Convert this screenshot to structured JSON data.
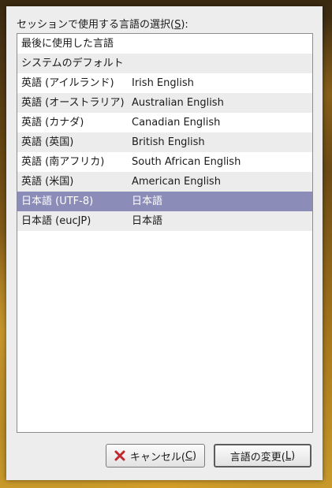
{
  "dialog": {
    "prompt_before": "セッションで使用する言語の選択(",
    "prompt_key": "S",
    "prompt_after": "):"
  },
  "languages": [
    {
      "name": "最後に使用した言語",
      "native": ""
    },
    {
      "name": "システムのデフォルト",
      "native": ""
    },
    {
      "name": "英語 (アイルランド)",
      "native": "Irish English"
    },
    {
      "name": "英語 (オーストラリア)",
      "native": "Australian English"
    },
    {
      "name": "英語 (カナダ)",
      "native": "Canadian English"
    },
    {
      "name": "英語 (英国)",
      "native": "British English"
    },
    {
      "name": "英語 (南アフリカ)",
      "native": "South African English"
    },
    {
      "name": "英語 (米国)",
      "native": "American English"
    },
    {
      "name": "日本語 (UTF-8)",
      "native": "日本語"
    },
    {
      "name": "日本語 (eucJP)",
      "native": "日本語"
    }
  ],
  "selected_index": 8,
  "buttons": {
    "cancel": {
      "before": "キャンセル(",
      "key": "C",
      "after": ")",
      "icon": "close-icon"
    },
    "change": {
      "before": "言語の変更(",
      "key": "L",
      "after": ")"
    }
  },
  "colors": {
    "selection": "#8b8cb8",
    "cancel_icon": "#c0282d"
  }
}
